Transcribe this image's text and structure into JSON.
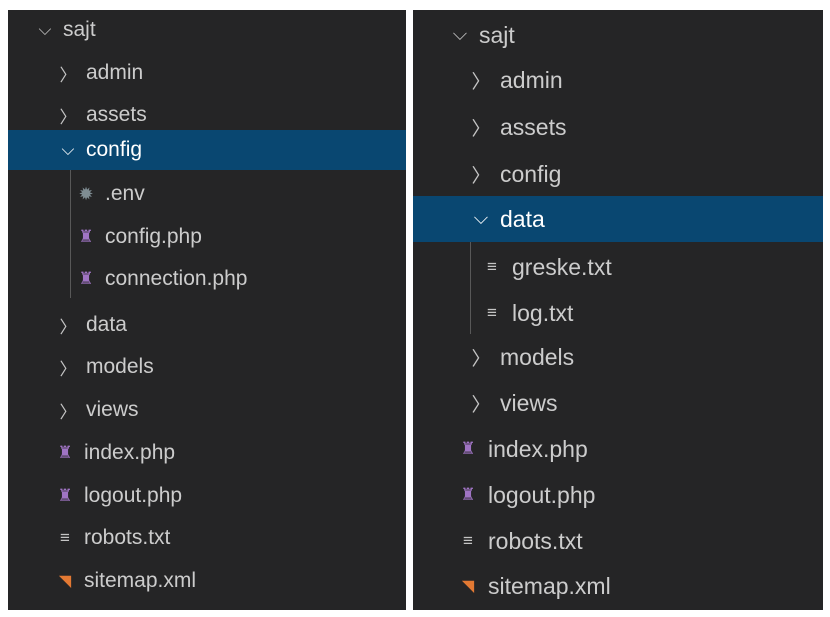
{
  "left_tree": {
    "root": "sajt",
    "folders_top": [
      "admin",
      "assets"
    ],
    "expanded_folder": "config",
    "expanded_children": [
      ".env",
      "config.php",
      "connection.php"
    ],
    "folders_bottom": [
      "data",
      "models",
      "views"
    ],
    "files": [
      "index.php",
      "logout.php",
      "robots.txt",
      "sitemap.xml"
    ]
  },
  "right_tree": {
    "root": "sajt",
    "folders_top": [
      "admin",
      "assets",
      "config"
    ],
    "expanded_folder": "data",
    "expanded_children": [
      "greske.txt",
      "log.txt"
    ],
    "folders_bottom": [
      "models",
      "views"
    ],
    "files": [
      "index.php",
      "logout.php",
      "robots.txt",
      "sitemap.xml"
    ]
  },
  "icons": {
    "chevron_right": "›",
    "chevron_down": "⌄",
    "php": "php-elephant-icon",
    "txt": "text-file-icon",
    "env": "gear-icon",
    "xml": "rss-icon"
  },
  "colors": {
    "background": "#252526",
    "selection": "#094771",
    "text": "#cccccc",
    "php_icon": "#a074c4",
    "xml_icon": "#e37933"
  }
}
